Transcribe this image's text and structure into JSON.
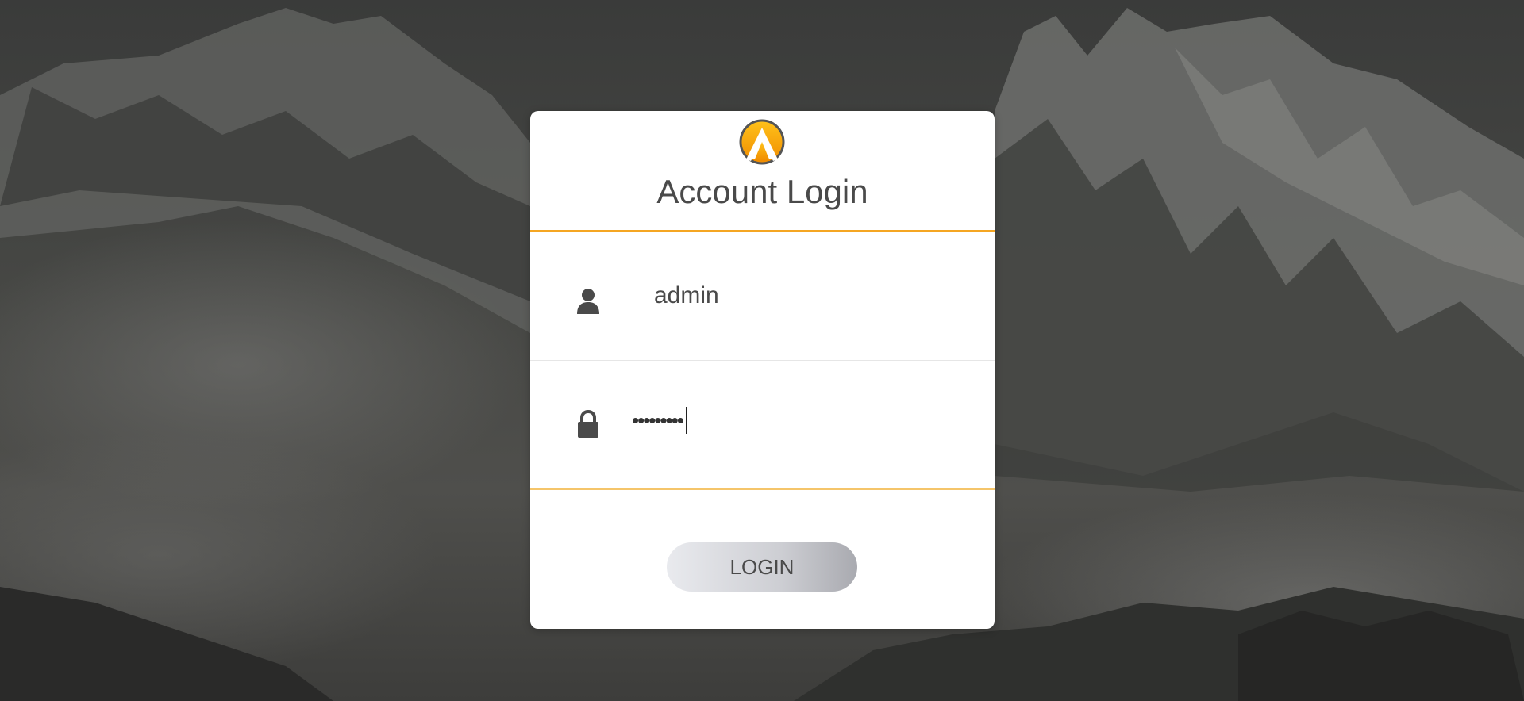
{
  "login": {
    "title": "Account Login",
    "username_value": "admin",
    "password_value": "•••••••••",
    "button_label": "LOGIN"
  },
  "icons": {
    "logo": "mountain-logo-icon",
    "user": "user-icon",
    "lock": "lock-icon"
  },
  "colors": {
    "accent": "#f5a623",
    "text": "#4a4a4a",
    "card": "#ffffff"
  }
}
